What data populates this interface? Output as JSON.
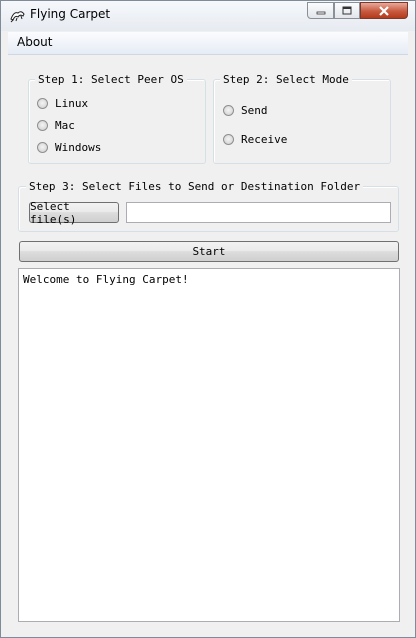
{
  "window": {
    "title": "Flying Carpet"
  },
  "menu": {
    "items": [
      {
        "label": "About"
      }
    ]
  },
  "step1": {
    "legend": "Step 1: Select Peer OS",
    "options": [
      {
        "label": "Linux"
      },
      {
        "label": "Mac"
      },
      {
        "label": "Windows"
      }
    ]
  },
  "step2": {
    "legend": "Step 2: Select Mode",
    "options": [
      {
        "label": "Send"
      },
      {
        "label": "Receive"
      }
    ]
  },
  "step3": {
    "legend": "Step 3: Select Files to Send or Destination Folder",
    "select_button": "Select file(s)",
    "path_value": ""
  },
  "start_button": "Start",
  "log": {
    "text": "Welcome to Flying Carpet!"
  },
  "colors": {
    "close_button": "#c75a3f",
    "group_border": "#d5dfe5"
  }
}
